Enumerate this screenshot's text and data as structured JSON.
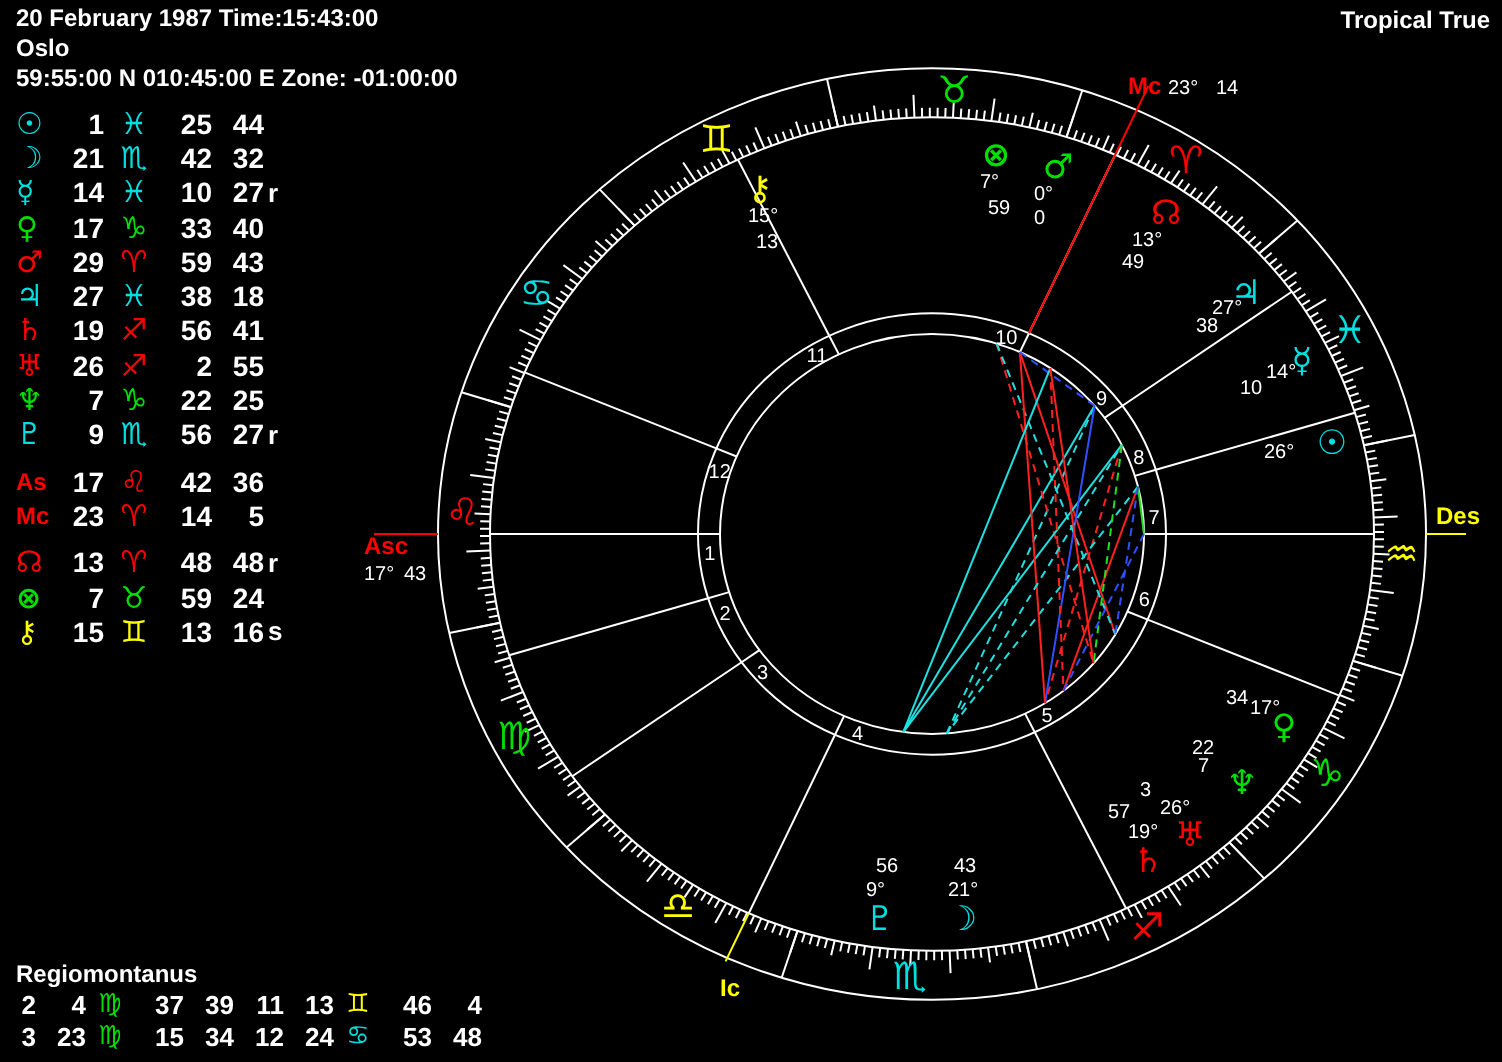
{
  "header": {
    "date_time": "20 February 1987 Time:15:43:00",
    "place": "Oslo",
    "coordinates": "59:55:00 N 010:45:00 E Zone: -01:00:00",
    "zodiac": "Tropical True"
  },
  "planets": [
    {
      "glyph": "☉",
      "color": "#00e0e0",
      "degree": "1",
      "sign": {
        "glyph": "♓",
        "color": "#00e0e0"
      },
      "minutes": "25",
      "seconds": "44"
    },
    {
      "glyph": "☽",
      "color": "#00e0e0",
      "degree": "21",
      "sign": {
        "glyph": "♏",
        "color": "#00e0e0"
      },
      "minutes": "42",
      "seconds": "32"
    },
    {
      "glyph": "☿",
      "color": "#00e0e0",
      "degree": "14",
      "sign": {
        "glyph": "♓",
        "color": "#00e0e0"
      },
      "minutes": "10",
      "seconds": "27",
      "suffix": "r"
    },
    {
      "glyph": "♀",
      "color": "#00e000",
      "degree": "17",
      "sign": {
        "glyph": "♑",
        "color": "#00e000"
      },
      "minutes": "33",
      "seconds": "40"
    },
    {
      "glyph": "♂",
      "color": "#ff0000",
      "degree": "29",
      "sign": {
        "glyph": "♈",
        "color": "#ff0000"
      },
      "minutes": "59",
      "seconds": "43"
    },
    {
      "glyph": "♃",
      "color": "#00e0e0",
      "degree": "27",
      "sign": {
        "glyph": "♓",
        "color": "#00e0e0"
      },
      "minutes": "38",
      "seconds": "18"
    },
    {
      "glyph": "♄",
      "color": "#ff0000",
      "degree": "19",
      "sign": {
        "glyph": "♐",
        "color": "#ff0000"
      },
      "minutes": "56",
      "seconds": "41"
    },
    {
      "glyph": "♅",
      "color": "#ff0000",
      "degree": "26",
      "sign": {
        "glyph": "♐",
        "color": "#ff0000"
      },
      "minutes": "2",
      "seconds": "55"
    },
    {
      "glyph": "♆",
      "color": "#00e000",
      "degree": "7",
      "sign": {
        "glyph": "♑",
        "color": "#00e000"
      },
      "minutes": "22",
      "seconds": "25"
    },
    {
      "glyph": "♇",
      "color": "#00e0e0",
      "degree": "9",
      "sign": {
        "glyph": "♏",
        "color": "#00e0e0"
      },
      "minutes": "56",
      "seconds": "27",
      "suffix": "r"
    }
  ],
  "angles": [
    {
      "glyph": "As",
      "color": "#ff0000",
      "degree": "17",
      "sign": {
        "glyph": "♌",
        "color": "#ff0000"
      },
      "minutes": "42",
      "seconds": "36"
    },
    {
      "glyph": "Mc",
      "color": "#ff0000",
      "degree": "23",
      "sign": {
        "glyph": "♈",
        "color": "#ff0000"
      },
      "minutes": "14",
      "seconds": "5"
    }
  ],
  "points": [
    {
      "glyph": "☊",
      "color": "#ff0000",
      "degree": "13",
      "sign": {
        "glyph": "♈",
        "color": "#ff0000"
      },
      "minutes": "48",
      "seconds": "48",
      "suffix": "r"
    },
    {
      "glyph": "⊗",
      "color": "#00e000",
      "degree": "7",
      "sign": {
        "glyph": "♉",
        "color": "#00e000"
      },
      "minutes": "59",
      "seconds": "24"
    },
    {
      "glyph": "⚷",
      "color": "#ffff00",
      "degree": "15",
      "sign": {
        "glyph": "♊",
        "color": "#ffff00"
      },
      "minutes": "13",
      "seconds": "16",
      "suffix": "s"
    }
  ],
  "house_system": {
    "title": "Regiomontanus",
    "rows": [
      {
        "cells": [
          "2",
          "4",
          "37",
          "39",
          "11",
          "13",
          "46",
          "4"
        ],
        "signs": [
          {
            "glyph": "♍",
            "color": "#00e000"
          },
          {
            "glyph": "♊",
            "color": "#ffff00"
          }
        ]
      },
      {
        "cells": [
          "3",
          "23",
          "15",
          "34",
          "12",
          "24",
          "53",
          "48"
        ],
        "signs": [
          {
            "glyph": "♍",
            "color": "#00e000"
          },
          {
            "glyph": "♋",
            "color": "#00e0e0"
          }
        ]
      }
    ]
  },
  "chart": {
    "signs": [
      {
        "glyph": "♈",
        "color": "#ff0000"
      },
      {
        "glyph": "♉",
        "color": "#00e000"
      },
      {
        "glyph": "♊",
        "color": "#ffff00"
      },
      {
        "glyph": "♋",
        "color": "#00e0e0"
      },
      {
        "glyph": "♌",
        "color": "#ff0000"
      },
      {
        "glyph": "♍",
        "color": "#00e000"
      },
      {
        "glyph": "♎",
        "color": "#ffff00"
      },
      {
        "glyph": "♏",
        "color": "#00e0e0"
      },
      {
        "glyph": "♐",
        "color": "#ff0000"
      },
      {
        "glyph": "♑",
        "color": "#00e000"
      },
      {
        "glyph": "♒",
        "color": "#ffff00"
      },
      {
        "glyph": "♓",
        "color": "#00e0e0"
      }
    ],
    "houses": [
      "1",
      "2",
      "3",
      "4",
      "5",
      "6",
      "7",
      "8",
      "9",
      "10",
      "11",
      "12"
    ],
    "angles": [
      {
        "kind": "asc",
        "label": "Asc",
        "color": "#ff0000",
        "degree": "17°",
        "minutes": "43"
      },
      {
        "kind": "des",
        "label": "Des",
        "color": "#ffff00"
      },
      {
        "kind": "mc",
        "label": "Mc",
        "color": "#ff0000",
        "degree": "23°",
        "minutes": "14"
      },
      {
        "kind": "ic",
        "label": "Ic",
        "color": "#ffff00"
      }
    ],
    "planets": [
      {
        "glyph": "⚷",
        "color": "#ffff00",
        "degree": "15°",
        "minutes": "13"
      },
      {
        "glyph": "⊗",
        "color": "#00e000",
        "degree": "7°",
        "minutes": "59"
      },
      {
        "glyph": "♂",
        "color": "#00e000",
        "degree": "0°",
        "minutes": "0"
      },
      {
        "glyph": "☊",
        "color": "#ff0000",
        "degree": "13°",
        "minutes": "49"
      },
      {
        "glyph": "♃",
        "color": "#00e0e0",
        "degree": "27°",
        "minutes": "38"
      },
      {
        "glyph": "☿",
        "color": "#00e0e0",
        "degree": "14°",
        "minutes": "10"
      },
      {
        "glyph": "☉",
        "color": "#00e0e0",
        "degree": "26°"
      },
      {
        "glyph": "♀",
        "color": "#00e000",
        "degree": "17°",
        "minutes": "34"
      },
      {
        "glyph": "♆",
        "color": "#00e000",
        "degree": "22",
        "minutes": "7"
      },
      {
        "glyph": "♅",
        "color": "#ff0000",
        "degree": "26°",
        "minutes": "3"
      },
      {
        "glyph": "♄",
        "color": "#ff0000",
        "degree": "19°",
        "minutes": "57"
      },
      {
        "glyph": "☽",
        "color": "#00e0e0",
        "degree": "21°",
        "minutes": "43"
      },
      {
        "glyph": "♇",
        "color": "#00e0e0",
        "degree": "9°",
        "minutes": "56"
      }
    ]
  }
}
